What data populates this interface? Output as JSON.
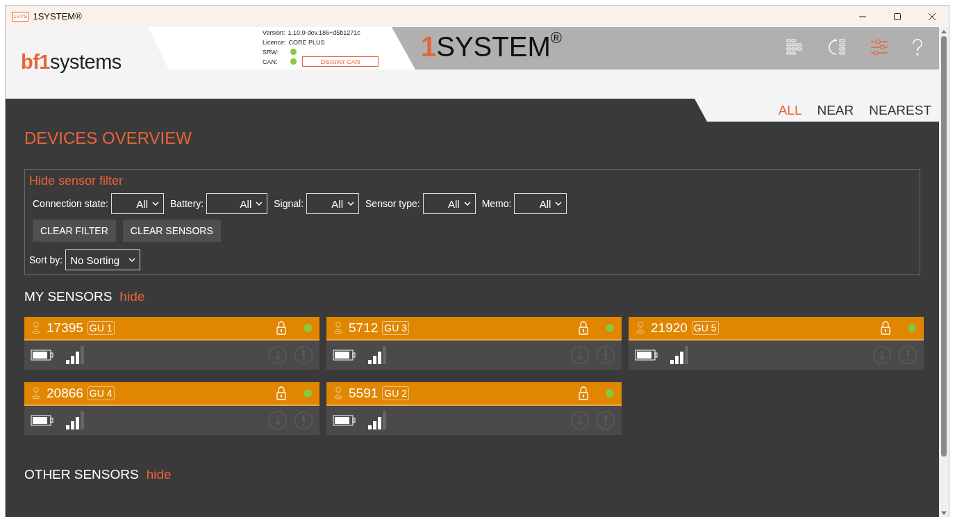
{
  "window": {
    "title": "1SYSTEM®",
    "app_icon": "1SYS"
  },
  "header": {
    "brand_orange": "bf1",
    "brand_dark": "systems",
    "version_label": "Version:",
    "version": "1.10.0-dev.186+d5b1271c",
    "licence_label": "Licence:",
    "licence": "CORE PLUS",
    "srw_label": "SRW:",
    "srw_ok": true,
    "can_label": "CAN:",
    "can_ok": true,
    "discover_button": "Discover CAN",
    "product_digit": "1",
    "product_name": "SYSTEM",
    "product_mark": "®"
  },
  "toolbar": [
    {
      "kind": "grid",
      "selected": false
    },
    {
      "kind": "refresh",
      "selected": false
    },
    {
      "kind": "sliders",
      "selected": true
    },
    {
      "kind": "help",
      "selected": false
    }
  ],
  "tabs": [
    {
      "label": "ALL",
      "selected": true
    },
    {
      "label": "NEAR",
      "selected": false
    },
    {
      "label": "NEAREST",
      "selected": false
    }
  ],
  "page_title": "DEVICES OVERVIEW",
  "filter": {
    "toggle": "Hide sensor filter",
    "fields": [
      {
        "label": "Connection state:",
        "value": "All"
      },
      {
        "label": "Battery:",
        "value": "All"
      },
      {
        "label": "Signal:",
        "value": "All"
      },
      {
        "label": "Sensor type:",
        "value": "All"
      },
      {
        "label": "Memo:",
        "value": "All"
      }
    ],
    "buttons": [
      "CLEAR FILTER",
      "CLEAR SENSORS"
    ],
    "sort_label": "Sort by:",
    "sort_value": "No Sorting"
  },
  "my_sensors": {
    "title": "MY SENSORS",
    "toggle": "hide",
    "sensors": [
      {
        "id": "17395",
        "group": "GU 1",
        "locked": true,
        "connected": true
      },
      {
        "id": "5712",
        "group": "GU 3",
        "locked": true,
        "connected": true
      },
      {
        "id": "21920",
        "group": "GU 5",
        "locked": true,
        "connected": true
      },
      {
        "id": "20866",
        "group": "GU 4",
        "locked": true,
        "connected": true
      },
      {
        "id": "5591",
        "group": "GU 2",
        "locked": true,
        "connected": true
      }
    ]
  },
  "other_sensors": {
    "title": "OTHER SENSORS",
    "toggle": "hide"
  }
}
